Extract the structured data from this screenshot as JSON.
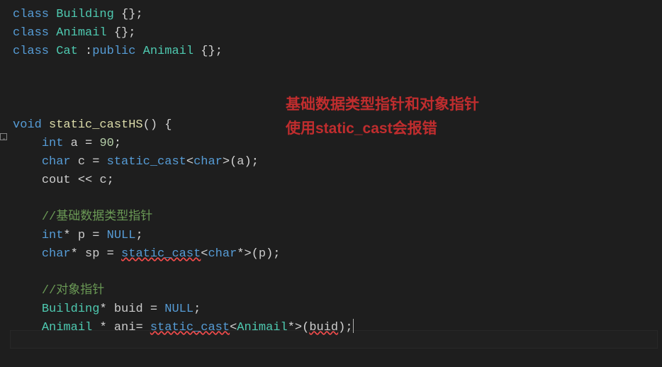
{
  "code": {
    "l1": {
      "kw1": "class",
      "cls": "Building",
      "br": "{}",
      "semi": ";"
    },
    "l2": {
      "kw1": "class",
      "cls": "Animail",
      "br": "{}",
      "semi": ";"
    },
    "l3": {
      "kw1": "class",
      "cls": "Cat",
      "colon": ":",
      "kw2": "public",
      "cls2": "Animail",
      "br": "{}",
      "semi": ";"
    },
    "l8": {
      "kw1": "void",
      "func": "static_castHS",
      "paren": "()",
      "br": "{"
    },
    "l9": {
      "type": "int",
      "var": "a",
      "eq": "=",
      "num": "90",
      "semi": ";"
    },
    "l10": {
      "type": "char",
      "var": "c",
      "eq": "=",
      "cast": "static_cast",
      "ang1": "<",
      "casttype": "char",
      "ang2": ">",
      "paren1": "(",
      "arg": "a",
      "paren2": ")",
      "semi": ";"
    },
    "l11": {
      "obj": "cout",
      "op": "<<",
      "var": "c",
      "semi": ";"
    },
    "l13": {
      "comment": "//基础数据类型指针"
    },
    "l14": {
      "type": "int",
      "star": "*",
      "var": "p",
      "eq": "=",
      "null": "NULL",
      "semi": ";"
    },
    "l15": {
      "type": "char",
      "star": "*",
      "var": "sp",
      "eq": "=",
      "cast": "static_cast",
      "ang1": "<",
      "casttype": "char",
      "caststar": "*",
      "ang2": ">",
      "paren1": "(",
      "arg": "p",
      "paren2": ")",
      "semi": ";"
    },
    "l17": {
      "comment": "//对象指针"
    },
    "l18": {
      "cls": "Building",
      "star": "*",
      "var": "buid",
      "eq": "=",
      "null": "NULL",
      "semi": ";"
    },
    "l19": {
      "cls": "Animail",
      "star": "*",
      "var": "ani",
      "eq": "=",
      "cast": "static_cast",
      "ang1": "<",
      "castcls": "Animail",
      "caststar": "*",
      "ang2": ">",
      "paren1": "(",
      "arg": "buid",
      "paren2": ")",
      "semi": ";"
    }
  },
  "annotation": {
    "line1": "基础数据类型指针和对象指针",
    "line2": "使用static_cast会报错"
  }
}
